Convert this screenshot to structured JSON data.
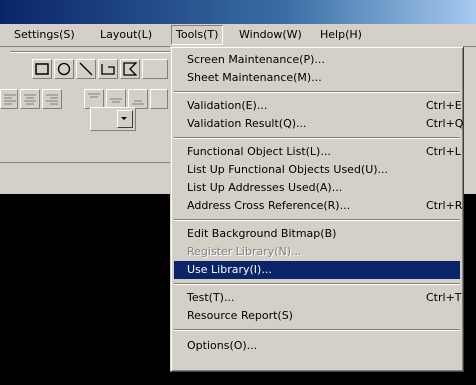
{
  "menubar": {
    "items": [
      {
        "label": "Settings(S)"
      },
      {
        "label": "Layout(L)"
      },
      {
        "label": "Tools(T)"
      },
      {
        "label": "Window(W)"
      },
      {
        "label": "Help(H)"
      }
    ]
  },
  "tools_menu": {
    "items": [
      {
        "label": "Screen Maintenance(P)...",
        "shortcut": ""
      },
      {
        "label": "Sheet Maintenance(M)...",
        "shortcut": ""
      },
      {
        "label": "Validation(E)...",
        "shortcut": "Ctrl+E"
      },
      {
        "label": "Validation Result(Q)...",
        "shortcut": "Ctrl+Q"
      },
      {
        "label": "Functional Object List(L)...",
        "shortcut": "Ctrl+L"
      },
      {
        "label": "List Up Functional Objects Used(U)...",
        "shortcut": ""
      },
      {
        "label": "List Up Addresses Used(A)...",
        "shortcut": ""
      },
      {
        "label": "Address Cross Reference(R)...",
        "shortcut": "Ctrl+R"
      },
      {
        "label": "Edit Background Bitmap(B)",
        "shortcut": ""
      },
      {
        "label": "Register Library(N)...",
        "shortcut": "",
        "disabled": true
      },
      {
        "label": "Use Library(I)...",
        "shortcut": "",
        "highlighted": true
      },
      {
        "label": "Test(T)...",
        "shortcut": "Ctrl+T"
      },
      {
        "label": "Resource Report(S)",
        "shortcut": ""
      },
      {
        "label": "Options(O)...",
        "shortcut": ""
      }
    ]
  },
  "colors": {
    "menu_bg": "#d4d0c8",
    "highlight": "#0a246a",
    "disabled_text": "#808080",
    "background": "#000000"
  }
}
